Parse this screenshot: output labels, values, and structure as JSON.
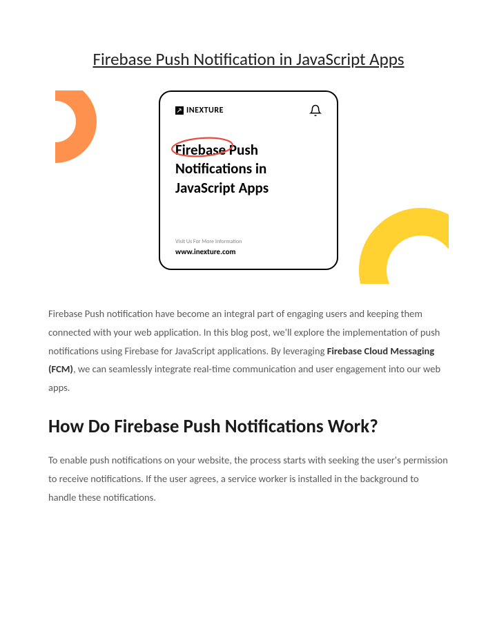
{
  "title": "Firebase Push Notification in JavaScript Apps",
  "card": {
    "logo_text": "INEXTURE",
    "logo_glyph": "↗",
    "bell_icon_name": "bell-icon",
    "heading_word1": "Firebase",
    "heading_rest": " Push Notifications in JavaScript Apps",
    "visit_label": "Visit Us For More Information",
    "url": "www.inexture.com"
  },
  "intro": {
    "text_before_bold": "Firebase Push notification have become an integral part of engaging users and keeping them connected with your web application. In this blog post, we'll explore the implementation of push notifications using Firebase for JavaScript applications. By leveraging ",
    "bold_text": "Firebase Cloud Messaging (FCM)",
    "text_after_bold": ", we can seamlessly integrate real-time communication and user engagement into our web apps."
  },
  "section_heading": "How Do Firebase Push Notifications Work?",
  "body_para": "To enable push notifications on your website, the process starts with seeking the user's permission to receive notifications. If the user agrees, a service worker is installed in the background to handle these notifications."
}
